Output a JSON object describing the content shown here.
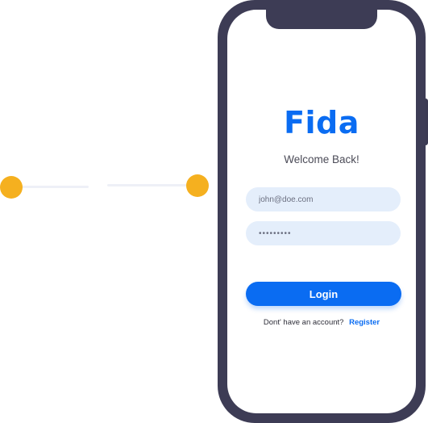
{
  "colors": {
    "accent": "#0a6cf2",
    "phone_frame": "#3d3c55",
    "input_background": "#e4eefb",
    "connector_dot": "#f5b01f"
  },
  "app": {
    "logo_text": "Fida",
    "welcome_text": "Welcome Back!"
  },
  "form": {
    "email": {
      "value": "john@doe.com"
    },
    "password": {
      "value": "•••••••••"
    },
    "login_label": "Login",
    "signup_prompt": "Dont' have an account?",
    "register_label": "Register"
  }
}
